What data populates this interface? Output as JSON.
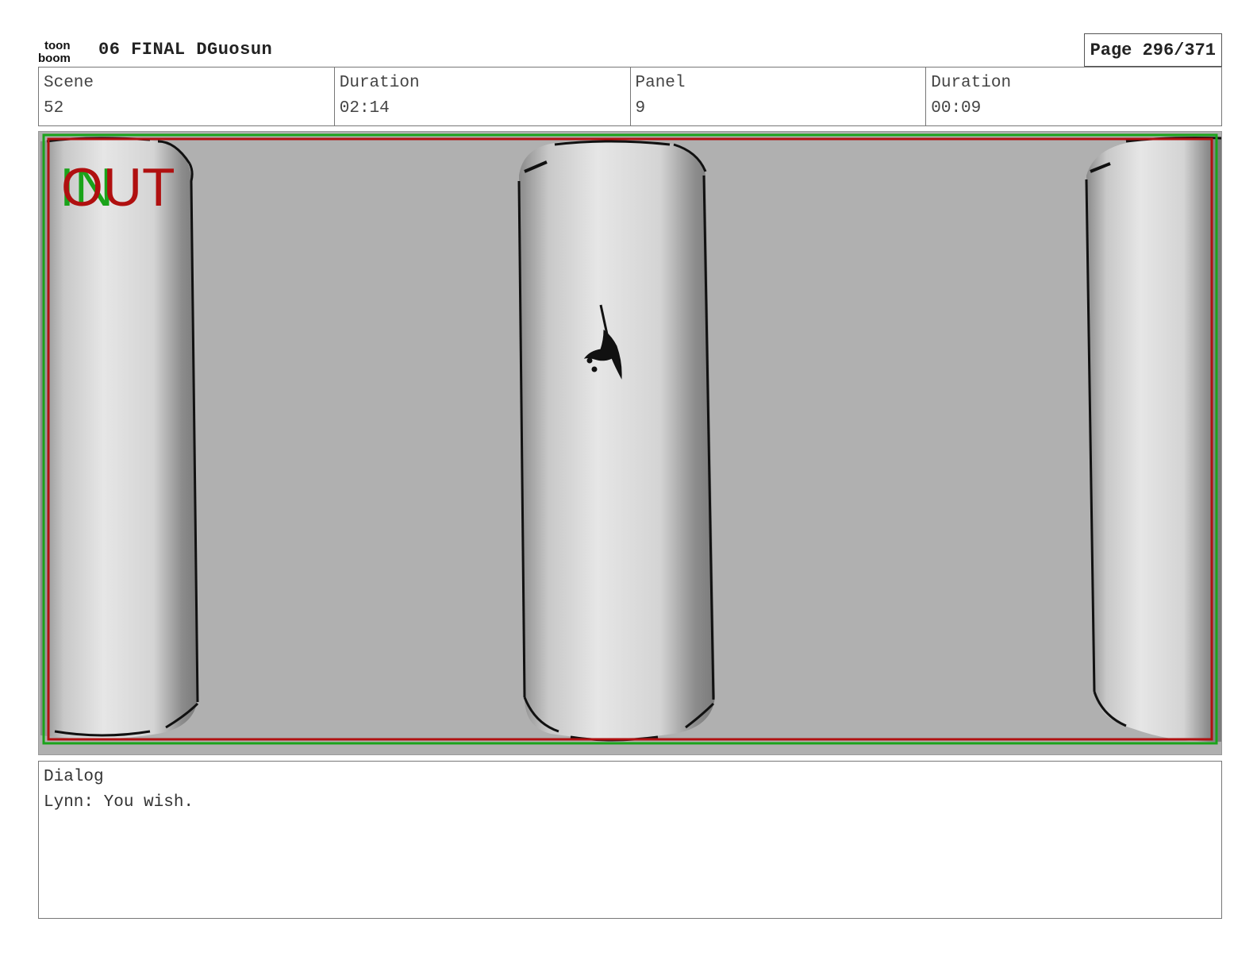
{
  "header": {
    "logo_text_top": "toon",
    "logo_text_bottom": "boom",
    "project_title": "06 FINAL DGuosun",
    "page_label": "Page 296/371"
  },
  "info": [
    {
      "label": "Scene",
      "value": "52"
    },
    {
      "label": "Duration",
      "value": "02:14"
    },
    {
      "label": "Panel",
      "value": "9"
    },
    {
      "label": "Duration",
      "value": "00:09"
    }
  ],
  "panel": {
    "overlay_in": "IN",
    "overlay_out": "OUT",
    "colors": {
      "in": "#1aa31a",
      "out": "#b01010",
      "background": "#b0b0b0"
    }
  },
  "dialog": {
    "label": "Dialog",
    "text": "Lynn: You wish."
  }
}
